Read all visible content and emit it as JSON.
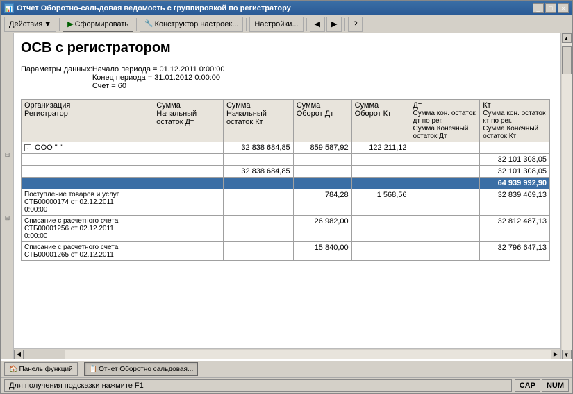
{
  "window": {
    "title": "Отчет  Оборотно-сальдовая ведомость с группировкой по регистратору",
    "controls": [
      "_",
      "□",
      "×"
    ]
  },
  "toolbar": {
    "actions_label": "Действия",
    "form_label": "Сформировать",
    "constructor_label": "Конструктор настроек...",
    "settings_label": "Настройки..."
  },
  "report": {
    "title": "ОСВ с регистратором",
    "params_label": "Параметры данных:",
    "param1": "Начало периода = 01.12.2011 0:00:00",
    "param2": "Конец периода = 31.01.2012 0:00:00",
    "param3": "Счет = 60"
  },
  "table": {
    "headers": {
      "col1_line1": "Организация",
      "col1_line2": "Регистратор",
      "col2_line1": "Сумма",
      "col2_line2": "Начальный",
      "col2_line3": "остаток Дт",
      "col3_line1": "Сумма",
      "col3_line2": "Начальный",
      "col3_line3": "остаток Кт",
      "col4_line1": "Сумма",
      "col4_line2": "Оборот Дт",
      "col5_line1": "Сумма",
      "col5_line2": "Оборот Кт",
      "col6_line1": "Дт",
      "col6_sub1": "Сумма кон. остаток дт по рег.",
      "col6_sub2": "Сумма Конечный остаток Дт",
      "col7_line1": "Кт",
      "col7_sub1": "Сумма кон. остаток кт по рег.",
      "col7_sub2": "Сумма Конечный остаток Кт"
    },
    "rows": [
      {
        "org": "ООО \"         \"",
        "sum_ndt": "",
        "sum_nkt": "32 838 684,85",
        "sum_odt": "859 587,92",
        "sum_okt": "122 211,12",
        "dt": "",
        "kt": "",
        "sub_kt": "32 101 308,05",
        "expand": "-"
      },
      {
        "org": "",
        "sum_ndt": "",
        "sum_nkt": "32 838 684,85",
        "sum_odt": "",
        "sum_okt": "",
        "dt": "",
        "kt": "",
        "sub_kt": "32 101 308,05",
        "expand": ""
      },
      {
        "org": "",
        "sum_ndt": "",
        "sum_nkt": "",
        "sum_odt": "",
        "sum_okt": "",
        "dt": "",
        "kt": "",
        "sub_kt": "64 939 992,90",
        "selected": true,
        "expand": ""
      },
      {
        "org": "Поступление товаров и услуг\nСТБ00000174 от 02.12.2011\n0:00:00",
        "sum_ndt": "",
        "sum_nkt": "",
        "sum_odt": "784,28",
        "sum_okt": "1 568,56",
        "dt": "",
        "kt": "",
        "sub_kt": "32 839 469,13",
        "expand": ""
      },
      {
        "org": "Списание с расчетного счета\nСТБ00001256 от 02.12.2011\n0:00:00",
        "sum_ndt": "",
        "sum_nkt": "",
        "sum_odt": "26 982,00",
        "sum_okt": "",
        "dt": "",
        "kt": "",
        "sub_kt": "32 812 487,13",
        "expand": ""
      },
      {
        "org": "Списание с расчетного счета\nСТБ00001265 от 02.12.2011",
        "sum_ndt": "",
        "sum_nkt": "",
        "sum_odt": "15 840,00",
        "sum_okt": "",
        "dt": "",
        "kt": "",
        "sub_kt": "32 796 647,13",
        "expand": ""
      }
    ]
  },
  "taskbar": {
    "panel_label": "Панель функций",
    "report_label": "Отчет  Оборотно сальдовая..."
  },
  "statusbar": {
    "hint": "Для получения подсказки нажмите F1",
    "cap": "CAP",
    "num": "NUM"
  }
}
